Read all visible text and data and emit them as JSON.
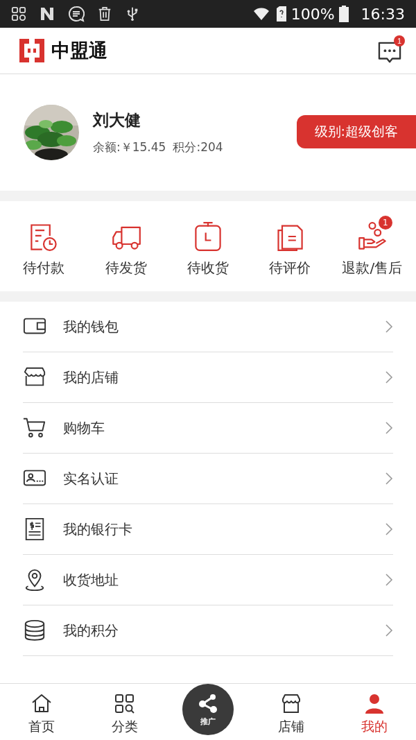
{
  "status_bar": {
    "battery": "100%",
    "time": "16:33"
  },
  "header": {
    "logo_text": "中盟通",
    "message_badge": "1"
  },
  "profile": {
    "name": "刘大健",
    "balance": "余额:￥15.45",
    "points": "积分:204",
    "level": "级别:超级创客"
  },
  "orders": [
    {
      "label": "待付款"
    },
    {
      "label": "待发货"
    },
    {
      "label": "待收货"
    },
    {
      "label": "待评价"
    },
    {
      "label": "退款/售后",
      "badge": "1"
    }
  ],
  "menu": [
    {
      "label": "我的钱包"
    },
    {
      "label": "我的店铺"
    },
    {
      "label": "购物车"
    },
    {
      "label": "实名认证"
    },
    {
      "label": "我的银行卡"
    },
    {
      "label": "收货地址"
    },
    {
      "label": "我的积分"
    }
  ],
  "tab_bar": [
    {
      "label": "首页",
      "kind": "tab",
      "selected": false
    },
    {
      "label": "分类",
      "kind": "tab",
      "selected": false
    },
    {
      "label": "推广",
      "kind": "center",
      "selected": false
    },
    {
      "label": "店铺",
      "kind": "tab",
      "selected": false
    },
    {
      "label": "我的",
      "kind": "tab",
      "selected": true
    }
  ]
}
